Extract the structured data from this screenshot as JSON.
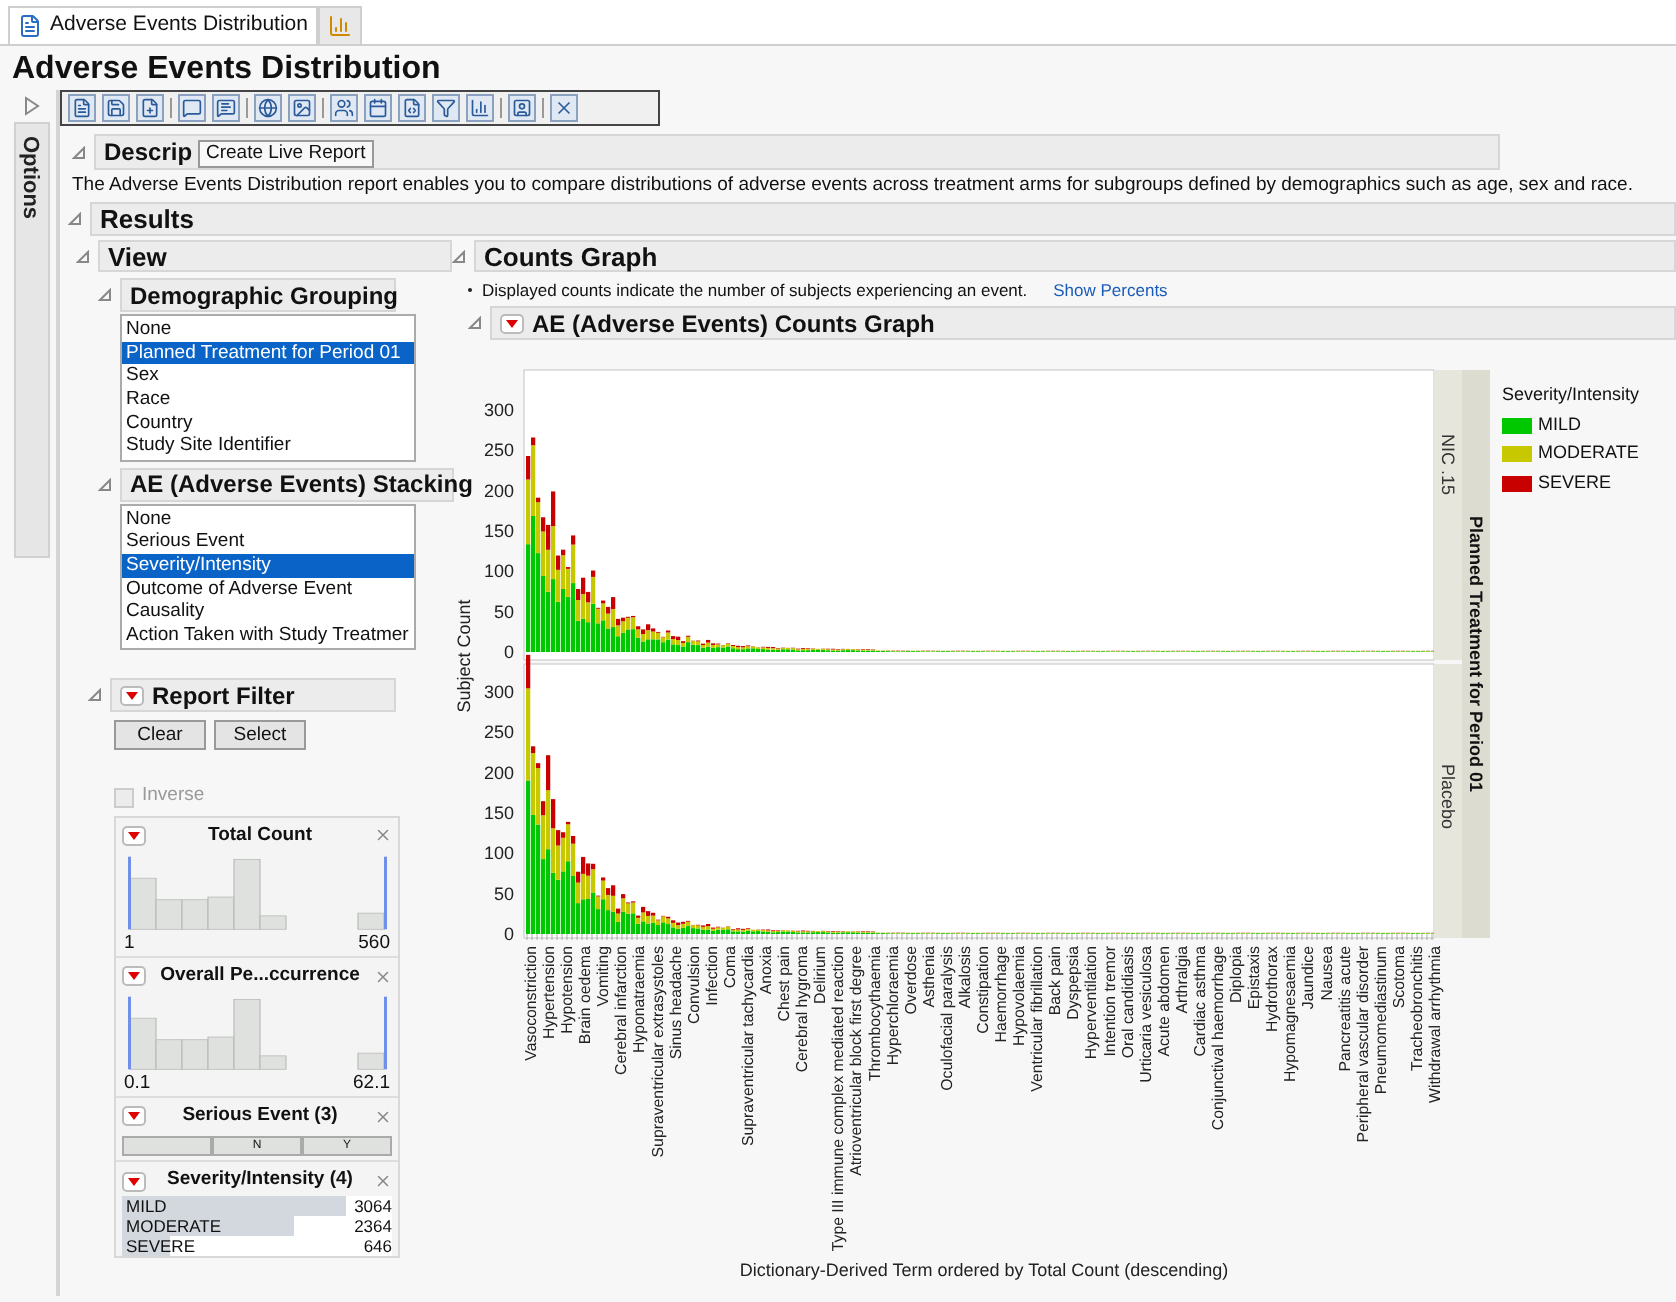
{
  "tabs": [
    {
      "kind": "report",
      "label": "Adverse Events Distribution",
      "selected": true
    },
    {
      "kind": "chart",
      "selected": false
    }
  ],
  "title": "Adverse Events Distribution",
  "options_label": "Options",
  "tooltip": "Create Live Report",
  "description": {
    "heading": "Descrip",
    "text": "The Adverse Events Distribution report enables you to compare distributions of adverse events across treatment arms for subgroups defined by demographics such as age, sex and race."
  },
  "results_heading": "Results",
  "view": {
    "heading": "View",
    "groups": [
      {
        "heading": "Demographic Grouping",
        "items": [
          {
            "label": "None",
            "selected": false
          },
          {
            "label": "Planned Treatment for Period 01",
            "selected": true
          },
          {
            "label": "Sex",
            "selected": false
          },
          {
            "label": "Race",
            "selected": false
          },
          {
            "label": "Country",
            "selected": false
          },
          {
            "label": "Study Site Identifier",
            "selected": false
          }
        ]
      },
      {
        "heading": "AE (Adverse Events) Stacking",
        "items": [
          {
            "label": "None",
            "selected": false
          },
          {
            "label": "Serious Event",
            "selected": false
          },
          {
            "label": "Severity/Intensity",
            "selected": true
          },
          {
            "label": "Outcome of Adverse Event",
            "selected": false
          },
          {
            "label": "Causality",
            "selected": false
          },
          {
            "label": "Action Taken with Study Treatmer",
            "selected": false
          }
        ]
      }
    ]
  },
  "report_filter": {
    "heading": "Report Filter",
    "buttons": [
      "Clear",
      "Select"
    ],
    "inverse": {
      "label": "Inverse",
      "checked": false,
      "disabled": true
    },
    "ranges": [
      {
        "title": "Total Count",
        "min": "1",
        "max": "560"
      },
      {
        "title": "Overall Pe...ccurrence",
        "min": "0.1",
        "max": "62.1"
      }
    ],
    "serious": {
      "title": "Serious Event (3)",
      "levels": [
        "N",
        "Y"
      ]
    },
    "severity": {
      "title": "Severity/Intensity (4)",
      "rows": [
        {
          "label": "MILD",
          "count": "3064",
          "level": 1.0
        },
        {
          "label": "MODERATE",
          "count": "2364",
          "level": 0.77
        },
        {
          "label": "SEVERE",
          "count": "646",
          "level": 0.21
        }
      ]
    }
  },
  "counts_graph": {
    "heading": "Counts Graph",
    "note": "Displayed counts indicate the number of subjects experiencing an event.",
    "link": "Show Percents",
    "graph_heading": "AE (Adverse Events) Counts Graph",
    "ylabel": "Subject Count",
    "panels": [
      {
        "label": "NIC .15",
        "yticks": [
          "300",
          "250",
          "200",
          "150",
          "100",
          "50",
          "0"
        ]
      },
      {
        "label": "Placebo",
        "yticks": [
          "300",
          "250",
          "200",
          "150",
          "100",
          "50",
          "0"
        ]
      }
    ],
    "group_title": "Planned Treatment for Period 01",
    "categories": [
      "Vasoconstriction",
      "Hypertension",
      "Hypotension",
      "Brain oedema",
      "Vomiting",
      "Cerebral infarction",
      "Hyponatraemia",
      "Supraventricular extrasystoles",
      "Sinus headache",
      "Convulsion",
      "Infection",
      "Coma",
      "Supraventricular tachycardia",
      "Anoxia",
      "Chest pain",
      "Cerebral hygroma",
      "Delirium",
      "Type III immune complex mediated reaction",
      "Atrioventricular block first degree",
      "Thrombocythaemia",
      "Hyperchloraemia",
      "Overdose",
      "Asthenia",
      "Oculofacial paralysis",
      "Alkalosis",
      "Constipation",
      "Haemorrhage",
      "Hypovolaemia",
      "Ventricular fibrillation",
      "Back pain",
      "Dyspepsia",
      "Hyperventilation",
      "Intention tremor",
      "Oral candidiasis",
      "Urticaria vesiculosa",
      "Acute abdomen",
      "Arthralgia",
      "Cardiac asthma",
      "Conjunctival haemorrhage",
      "Diplopia",
      "Epistaxis",
      "Hydrothorax",
      "Hypomagnesaemia",
      "Jaundice",
      "Nausea",
      "Pancreatitis acute",
      "Peripheral vascular disorder",
      "Pneumomediastinum",
      "Scotoma",
      "Tracheobronchitis",
      "Withdrawal arrhythmia"
    ],
    "xlabel": "Dictionary-Derived Term ordered by Total Count (descending)",
    "legend": {
      "title": "Severity/Intensity",
      "items": [
        {
          "label": "MILD",
          "color": "#00c800"
        },
        {
          "label": "MODERATE",
          "color": "#c8c800"
        },
        {
          "label": "SEVERE",
          "color": "#c80000"
        }
      ]
    }
  }
}
